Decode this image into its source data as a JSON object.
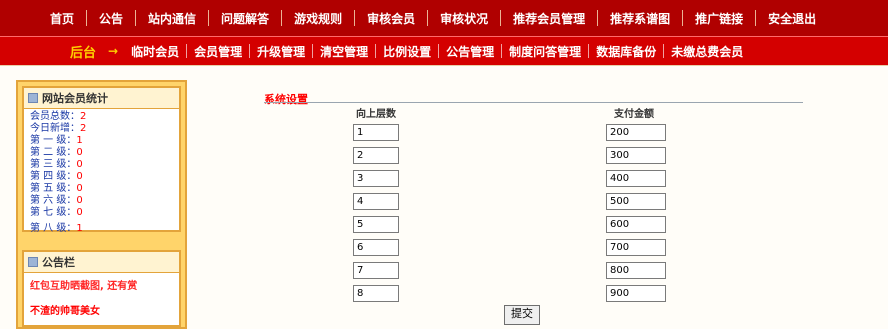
{
  "top_nav": [
    "首页",
    "公告",
    "站内通信",
    "问题解答",
    "游戏规则",
    "审核会员",
    "审核状况",
    "推荐会员管理",
    "推荐系谱图",
    "推广链接",
    "安全退出"
  ],
  "sub_nav": {
    "brand": "后台",
    "arrow": "→",
    "items": [
      "临时会员",
      "会员管理",
      "升级管理",
      "清空管理",
      "比例设置",
      "公告管理",
      "制度问答管理",
      "数据库备份",
      "未缴总费会员"
    ]
  },
  "left_panel": {
    "stats_title": "网站会员统计",
    "stats": [
      {
        "label": "会员总数：",
        "value": "2"
      },
      {
        "label": "今日新增：",
        "value": "2"
      },
      {
        "label": "第 一 级：",
        "value": "1"
      },
      {
        "label": "第 二 级：",
        "value": "0"
      },
      {
        "label": "第 三 级：",
        "value": "0"
      },
      {
        "label": "第 四 级：",
        "value": "0"
      },
      {
        "label": "第 五 级：",
        "value": "0"
      },
      {
        "label": "第 六 级：",
        "value": "0"
      },
      {
        "label": "第 七 级：",
        "value": "0"
      },
      {
        "label": "第 八 级：",
        "value": "1"
      }
    ],
    "notice_title": "公告栏",
    "notice_lines": [
      "红包互助晒截图, 还有赏",
      "不渣的帅哥美女"
    ]
  },
  "main": {
    "section_title": "系统设置",
    "col_layers": "向上层数",
    "col_amount": "支付金额",
    "rows": [
      {
        "layer": "1",
        "amount": "200"
      },
      {
        "layer": "2",
        "amount": "300"
      },
      {
        "layer": "3",
        "amount": "400"
      },
      {
        "layer": "4",
        "amount": "500"
      },
      {
        "layer": "5",
        "amount": "600"
      },
      {
        "layer": "6",
        "amount": "700"
      },
      {
        "layer": "7",
        "amount": "800"
      },
      {
        "layer": "8",
        "amount": "900"
      }
    ],
    "submit_label": "提交"
  }
}
